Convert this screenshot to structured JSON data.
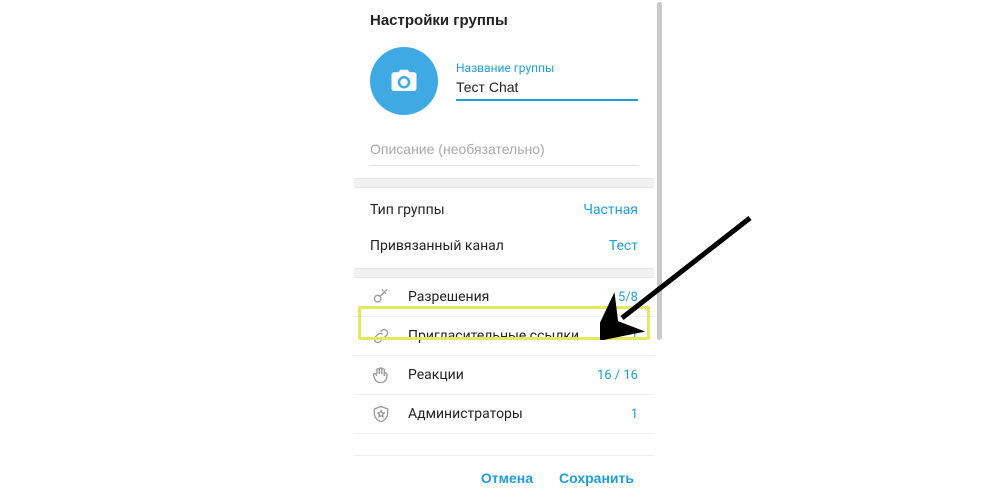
{
  "colors": {
    "accent": "#1e9ed9",
    "highlight": "#e6e861"
  },
  "header": {
    "title": "Настройки группы"
  },
  "group": {
    "name_label": "Название группы",
    "name_value": "Тест Chat",
    "description_placeholder": "Описание (необязательно)",
    "description_value": ""
  },
  "info": [
    {
      "label": "Тип группы",
      "value": "Частная"
    },
    {
      "label": "Привязанный канал",
      "value": "Тест"
    }
  ],
  "menu": [
    {
      "icon": "key-icon",
      "label": "Разрешения",
      "count": "5/8",
      "highlighted": true
    },
    {
      "icon": "link-icon",
      "label": "Пригласительные ссылки",
      "count": "1"
    },
    {
      "icon": "wave-icon",
      "label": "Реакции",
      "count": "16 / 16"
    },
    {
      "icon": "shield-icon",
      "label": "Администраторы",
      "count": "1"
    }
  ],
  "buttons": {
    "cancel": "Отмена",
    "save": "Сохранить"
  }
}
